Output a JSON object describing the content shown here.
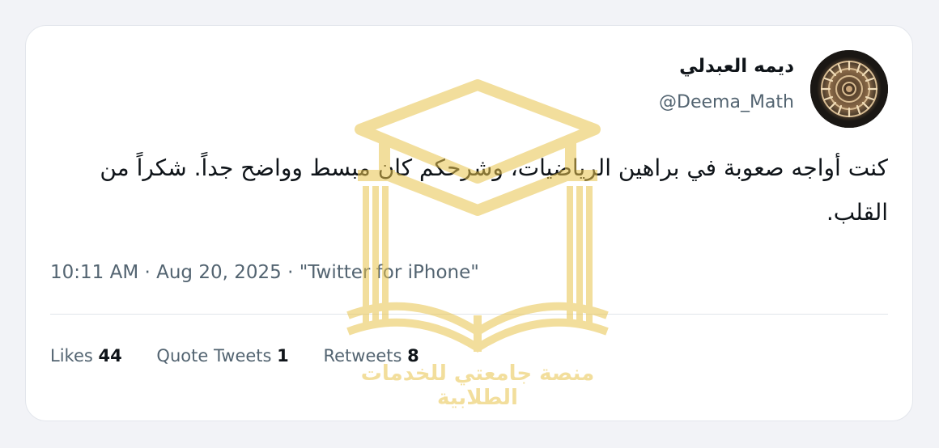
{
  "tweet": {
    "display_name": "ديمه العبدلي",
    "handle": "@Deema_Math",
    "text": "كنت أواجه صعوبة في براهين الرياضيات، وشرحكم كان مبسط وواضح جداً. شكراً من القلب.",
    "time": "10:11 AM",
    "separator": "·",
    "date": "Aug 20, 2025",
    "source": "\"Twitter for iPhone\""
  },
  "stats": {
    "likes_label": "Likes",
    "likes_count": "44",
    "quotes_label": "Quote Tweets",
    "quotes_count": "1",
    "retweets_label": "Retweets",
    "retweets_count": "8"
  },
  "watermark": {
    "text": "منصة جامعتي للخدمات الطلابية",
    "icon": "graduation-cap-book-icon",
    "color": "#e9c44d"
  },
  "avatar": {
    "icon": "ammonite-fossil-icon"
  },
  "colors": {
    "background": "#f2f3f7",
    "card": "#ffffff",
    "text_primary": "#0f1419",
    "text_secondary": "#536471"
  }
}
